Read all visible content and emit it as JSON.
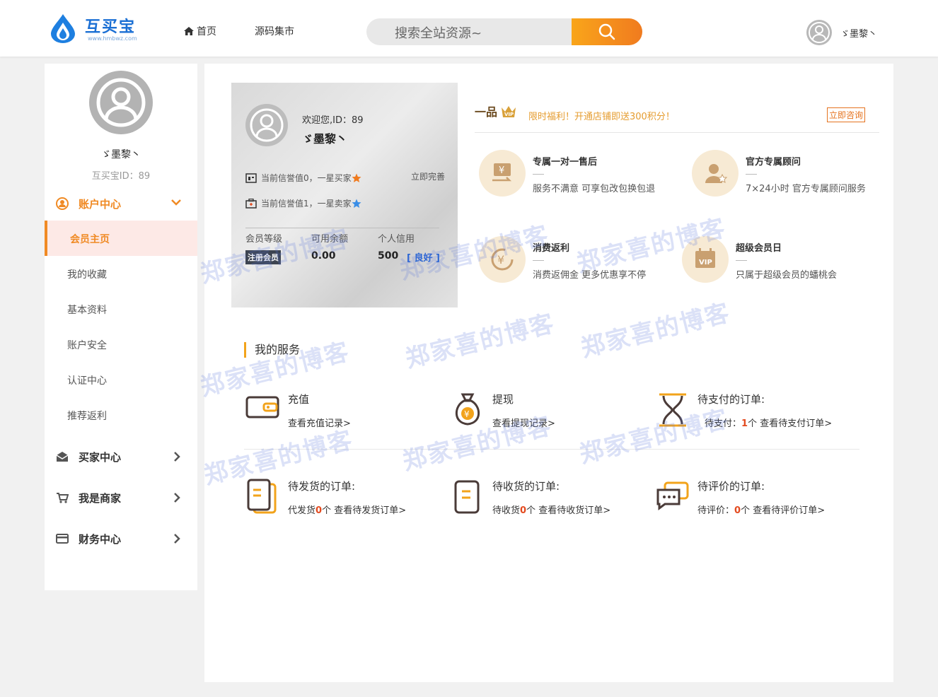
{
  "header": {
    "logo_text": "互买宝",
    "logo_url": "www.hmbwz.com",
    "nav": [
      {
        "label": "首页"
      },
      {
        "label": "源码集市"
      }
    ],
    "search_placeholder": "搜索全站资源~",
    "username": "ゞ墨黎丶"
  },
  "sidebar": {
    "username": "ゞ墨黎丶",
    "user_id": "互买宝ID：89",
    "account_center": "账户中心",
    "sub_items": [
      {
        "label": "会员主页"
      },
      {
        "label": "我的收藏"
      },
      {
        "label": "基本资料"
      },
      {
        "label": "账户安全"
      },
      {
        "label": "认证中心"
      },
      {
        "label": "推荐返利"
      }
    ],
    "menus": [
      {
        "label": "买家中心"
      },
      {
        "label": "我是商家"
      },
      {
        "label": "财务中心"
      }
    ]
  },
  "card": {
    "welcome": "欢迎您,ID：89",
    "name": "ゞ墨黎丶",
    "buyer_rep": "当前信誉值0，一星买家",
    "seller_rep": "当前信誉值1，一星卖家",
    "complete_link": "立即完善",
    "stat_labels": [
      "会员等级",
      "可用余额",
      "个人信用"
    ],
    "level_badge": "注册会员",
    "balance": "0.00",
    "credit": "500",
    "credit_tag": "[ 良好 ]"
  },
  "vip": {
    "logo_text": "一品VIP",
    "logo_url": "www.epmao.com",
    "promo": "限时福利！开通店铺即送300积分！",
    "consult": "立即咨询"
  },
  "features": [
    {
      "title": "专属一对一售后",
      "desc": "服务不满意 可享包改包换包退"
    },
    {
      "title": "官方专属顾问",
      "desc": "7×24小时 官方专属顾问服务"
    },
    {
      "title": "消费返利",
      "desc": "消费返佣金 更多优惠享不停"
    },
    {
      "title": "超级会员日",
      "desc": "只属于超级会员的蟠桃会"
    }
  ],
  "services_title": "我的服务",
  "services": [
    {
      "title": "充值",
      "pre": "",
      "count": "",
      "link": "查看充值记录>"
    },
    {
      "title": "提现",
      "pre": "",
      "count": "",
      "link": "查看提现记录>"
    },
    {
      "title": "待支付的订单:",
      "pre": "待支付：",
      "count": "1",
      "link": "个 查看待支付订单>"
    },
    {
      "title": "待发货的订单:",
      "pre": "代发货",
      "count": "0",
      "link": "个 查看待发货订单>"
    },
    {
      "title": "待收货的订单:",
      "pre": "待收货",
      "count": "0",
      "link": "个 查看待收货订单>"
    },
    {
      "title": "待评价的订单:",
      "pre": "待评价：",
      "count": "0",
      "link": "个 查看待评价订单>"
    }
  ],
  "watermark": "郑家喜的博客",
  "colors": {
    "accent": "#f08a24",
    "search_btn": "#f79a1c",
    "vip_gold": "#e59c2f",
    "good_blue": "#2a66d3"
  }
}
